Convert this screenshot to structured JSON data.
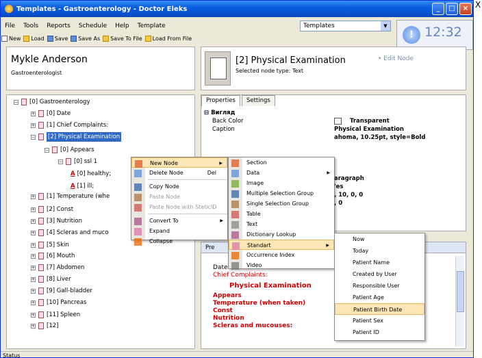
{
  "window": {
    "title": "Templates - Gastroenterology - Doctor Eleks",
    "close_glyph": "X"
  },
  "menubar": [
    "File",
    "Tools",
    "Reports",
    "Schedule",
    "Help",
    "Template"
  ],
  "template_combo": {
    "value": "Templates"
  },
  "toolbar": [
    "New",
    "Load",
    "Save",
    "Save As",
    "Save To File",
    "Load From File"
  ],
  "clock": {
    "time": "12:32",
    "info": "!"
  },
  "patient": {
    "name": "Mykle Anderson",
    "role": "Gastroenterologist"
  },
  "node_header": {
    "title": "[2] Physical Examination",
    "subtitle": "Selected node type: Text",
    "edit": "Edit Node"
  },
  "tree": [
    {
      "label": "[0] Gastroenterology",
      "pm": "−"
    },
    {
      "label": "[0] Date",
      "pm": "+"
    },
    {
      "label": "[1] Chief Complaints:",
      "pm": "+"
    },
    {
      "label": "[2] Physical Examination",
      "pm": "−"
    },
    {
      "label": "[0] Appears",
      "pm": "−"
    },
    {
      "label": "[0] ssl 1",
      "pm": "−"
    },
    {
      "label": "[0] healthy;",
      "a": "A"
    },
    {
      "label": "[1] ill;",
      "a": "A"
    },
    {
      "label": "[1] Temperature (whe",
      "pm": "+"
    },
    {
      "label": "[2] Const",
      "pm": "+"
    },
    {
      "label": "[3] Nutrition",
      "pm": "+"
    },
    {
      "label": "[4] Scleras and muco",
      "pm": "+"
    },
    {
      "label": "[5] Skin",
      "pm": "+"
    },
    {
      "label": "[6] Mouth",
      "pm": "+"
    },
    {
      "label": "[7] Abdomen",
      "pm": "+"
    },
    {
      "label": "[8] Liver",
      "pm": "+"
    },
    {
      "label": "[9] Gall-bladder",
      "pm": "+"
    },
    {
      "label": "[10] Pancreas",
      "pm": "+"
    },
    {
      "label": "[11] Spleen",
      "pm": "+"
    },
    {
      "label": "[12]",
      "pm": "+"
    }
  ],
  "props": {
    "tabs": [
      "Properties",
      "Settings"
    ],
    "group": "⊟ Вигляд",
    "rows": [
      {
        "k": "Back Color",
        "v": "Transparent"
      },
      {
        "k": "Caption",
        "v": "Physical Examination"
      },
      {
        "k": "",
        "v": "ahoma, 10.25pt, style=Bold"
      },
      {
        "k": "",
        "v": ""
      },
      {
        "k": "",
        "v": ""
      },
      {
        "k": "",
        "v": ""
      },
      {
        "k": "",
        "v": ""
      },
      {
        "k": "",
        "v": "aragraph"
      },
      {
        "k": "",
        "v": "'es"
      },
      {
        "k": "",
        "v": ", 10, 0, 0"
      },
      {
        "k": "",
        "v": ", 0"
      }
    ]
  },
  "preview": {
    "tab": "Pre",
    "lines": [
      {
        "t": "Date ...",
        "c": ""
      },
      {
        "t": "Chief Complaints:",
        "c": "red"
      },
      {
        "t": "Physical Examination",
        "c": "rb",
        "indent": true
      },
      {
        "t": "Appears",
        "c": "rb"
      },
      {
        "t": "Temperature (when taken)",
        "c": "rb"
      },
      {
        "t": "Const",
        "c": "rb"
      },
      {
        "t": "Nutrition",
        "c": "rb"
      },
      {
        "t": "Scleras and mucouses:",
        "c": "rb"
      }
    ]
  },
  "context_menu": {
    "items": [
      {
        "label": "New Node",
        "arrow": "▶",
        "hl": true
      },
      {
        "label": "Delete Node",
        "shortcut": "Del"
      },
      {
        "sep": true
      },
      {
        "label": "Copy Node"
      },
      {
        "label": "Paste Node",
        "dis": true
      },
      {
        "label": "Paste Node with StaticID",
        "dis": true
      },
      {
        "sep": true
      },
      {
        "label": "Convert To",
        "arrow": "▶"
      },
      {
        "label": "Expand"
      },
      {
        "label": "Collapse"
      }
    ]
  },
  "new_node_menu": {
    "items": [
      {
        "label": "Section"
      },
      {
        "label": "Data",
        "arrow": "▶"
      },
      {
        "label": "Image"
      },
      {
        "label": "Multiple Selection Group"
      },
      {
        "label": "Single Selection Group"
      },
      {
        "label": "Table"
      },
      {
        "label": "Text"
      },
      {
        "label": "Dictionary Lookup"
      },
      {
        "label": "Standart",
        "arrow": "▶",
        "hl": true,
        "icon": "abc"
      },
      {
        "label": "Occurrence Index"
      },
      {
        "label": "Video"
      }
    ]
  },
  "standart_menu": {
    "items": [
      {
        "label": "Now"
      },
      {
        "label": "Today"
      },
      {
        "label": "Patient Name"
      },
      {
        "label": "Created by User"
      },
      {
        "label": "Responsible User"
      },
      {
        "label": "Patient Age"
      },
      {
        "label": "Patient Birth Date",
        "hl": true
      },
      {
        "label": "Patient Sex"
      },
      {
        "label": "Patient ID"
      }
    ]
  },
  "status": "Status"
}
